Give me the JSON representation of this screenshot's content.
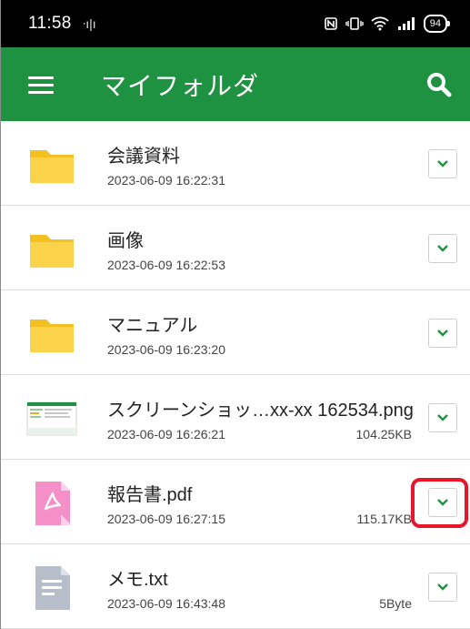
{
  "status_bar": {
    "time": "11:58",
    "notification": "ᐧı|ı",
    "icons": [
      "nfc-icon",
      "vibrate-icon",
      "wifi-icon",
      "signal-icon"
    ],
    "battery": "94"
  },
  "app_bar": {
    "title": "マイフォルダ",
    "color": "#1f9242"
  },
  "files": [
    {
      "type": "folder",
      "name": "会議資料",
      "date": "2023-06-09 16:22:31",
      "size": ""
    },
    {
      "type": "folder",
      "name": "画像",
      "date": "2023-06-09 16:22:53",
      "size": ""
    },
    {
      "type": "folder",
      "name": "マニュアル",
      "date": "2023-06-09 16:23:20",
      "size": ""
    },
    {
      "type": "image",
      "name": "スクリーンショッ…xx-xx 162534.png",
      "date": "2023-06-09 16:26:21",
      "size": "104.25KB"
    },
    {
      "type": "pdf",
      "name": "報告書.pdf",
      "date": "2023-06-09 16:27:15",
      "size": "115.17KB"
    },
    {
      "type": "text",
      "name": "メモ.txt",
      "date": "2023-06-09 16:43:48",
      "size": "5Byte"
    }
  ],
  "highlight_color": "#e8162a"
}
